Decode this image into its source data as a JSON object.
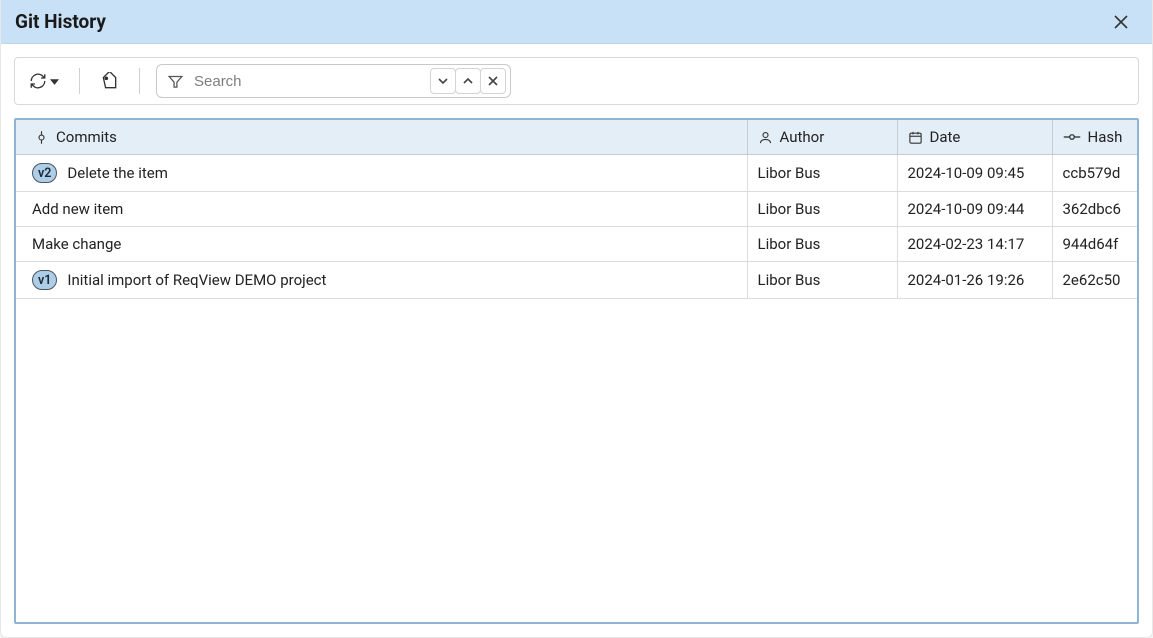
{
  "title": "Git History",
  "search": {
    "placeholder": "Search"
  },
  "columns": {
    "commits": "Commits",
    "author": "Author",
    "date": "Date",
    "hash": "Hash"
  },
  "rows": [
    {
      "tag": "v2",
      "message": "Delete the item",
      "author": "Libor Bus",
      "date": "2024-10-09 09:45",
      "hash": "ccb579d"
    },
    {
      "tag": null,
      "message": "Add new item",
      "author": "Libor Bus",
      "date": "2024-10-09 09:44",
      "hash": "362dbc6"
    },
    {
      "tag": null,
      "message": "Make change",
      "author": "Libor Bus",
      "date": "2024-02-23 14:17",
      "hash": "944d64f"
    },
    {
      "tag": "v1",
      "message": "Initial import of ReqView DEMO project",
      "author": "Libor Bus",
      "date": "2024-01-26 19:26",
      "hash": "2e62c50"
    }
  ]
}
